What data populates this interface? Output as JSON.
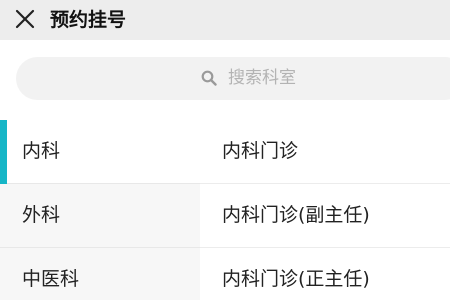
{
  "header": {
    "title": "预约挂号",
    "close_icon": "close-icon"
  },
  "search": {
    "placeholder": "搜索科室",
    "icon": "search-icon"
  },
  "departments": [
    {
      "label": "内科",
      "selected": true
    },
    {
      "label": "外科",
      "selected": false
    },
    {
      "label": "中医科",
      "selected": false
    }
  ],
  "clinics": [
    {
      "label": "内科门诊"
    },
    {
      "label": "内科门诊(副主任)"
    },
    {
      "label": "内科门诊(正主任)"
    }
  ],
  "colors": {
    "accent": "#16b6c7",
    "header_bg": "#ededed",
    "sidebar_bg": "#f7f7f7",
    "search_bg": "#f2f2f2",
    "placeholder_text": "#b3b3b3"
  }
}
